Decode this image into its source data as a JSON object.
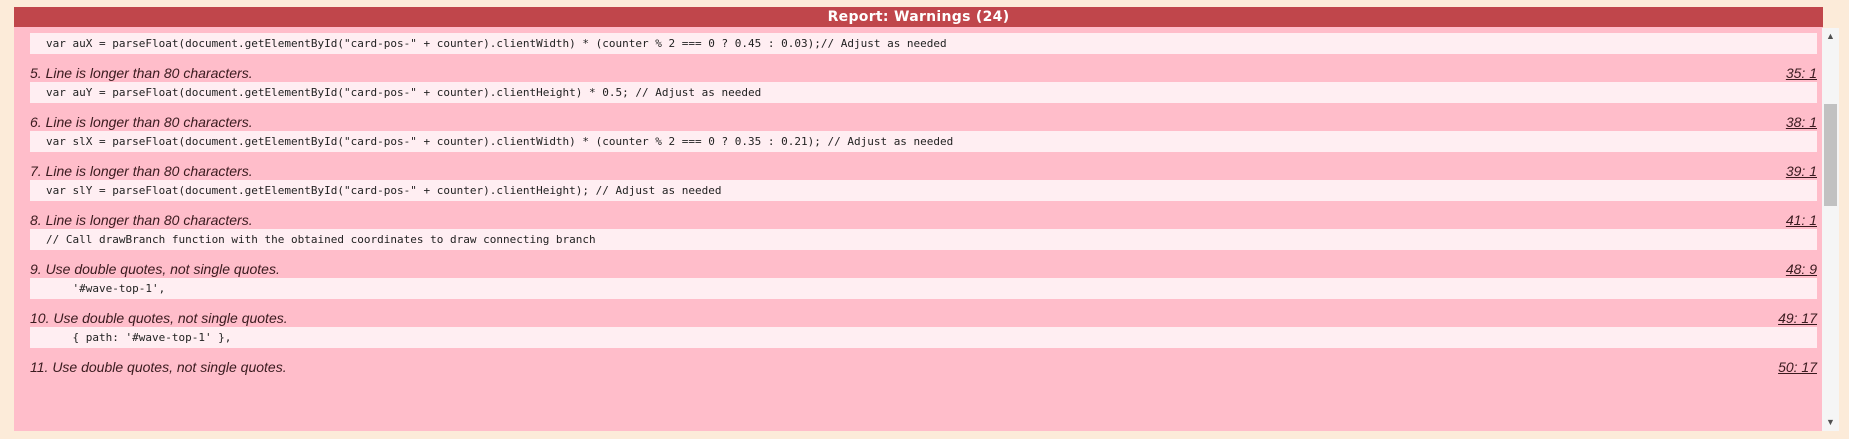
{
  "header": {
    "title": "Report: Warnings (24)"
  },
  "top_code": "var auX = parseFloat(document.getElementById(\"card-pos-\" + counter).clientWidth) * (counter % 2 === 0 ? 0.45 : 0.03);// Adjust as needed",
  "warnings": [
    {
      "message": "5. Line is longer than 80 characters.",
      "location": "35: 1",
      "code": "var auY = parseFloat(document.getElementById(\"card-pos-\" + counter).clientHeight) * 0.5; // Adjust as needed"
    },
    {
      "message": "6. Line is longer than 80 characters.",
      "location": "38: 1",
      "code": "var slX = parseFloat(document.getElementById(\"card-pos-\" + counter).clientWidth) * (counter % 2 === 0 ? 0.35 : 0.21); // Adjust as needed"
    },
    {
      "message": "7. Line is longer than 80 characters.",
      "location": "39: 1",
      "code": "var slY = parseFloat(document.getElementById(\"card-pos-\" + counter).clientHeight); // Adjust as needed"
    },
    {
      "message": "8. Line is longer than 80 characters.",
      "location": "41: 1",
      "code": "// Call drawBranch function with the obtained coordinates to draw connecting branch"
    },
    {
      "message": "9. Use double quotes, not single quotes.",
      "location": "48: 9",
      "code": "    '#wave-top-1',"
    },
    {
      "message": "10. Use double quotes, not single quotes.",
      "location": "49: 17",
      "code": "    { path: '#wave-top-1' },"
    },
    {
      "message": "11. Use double quotes, not single quotes.",
      "location": "50: 17",
      "code": ""
    }
  ],
  "scrollbar": {
    "up_glyph": "▲",
    "down_glyph": "▼"
  }
}
